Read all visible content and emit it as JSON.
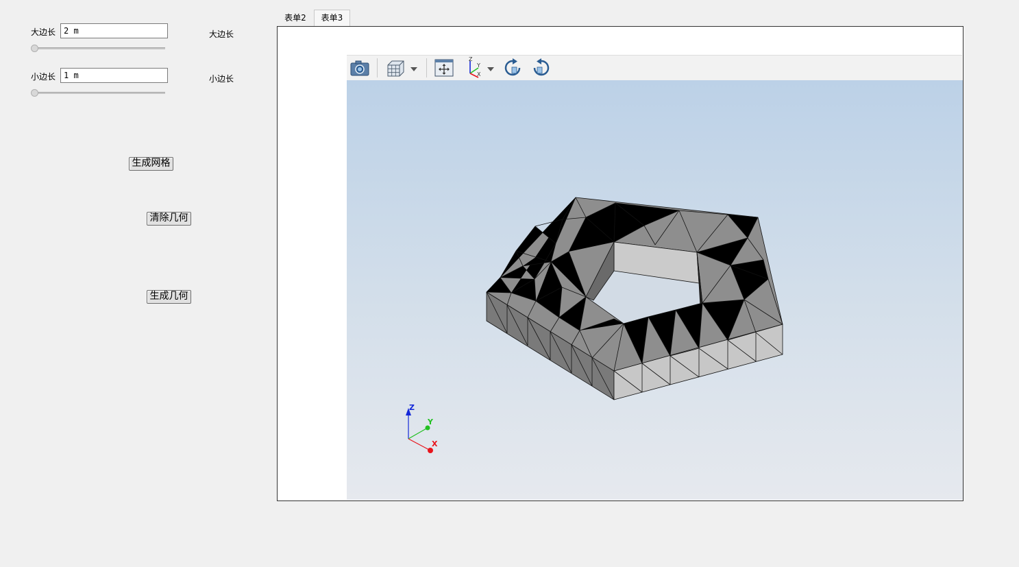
{
  "form": {
    "big_side_label": "大边长",
    "big_side_value": "2 m",
    "big_side_right_label": "大边长",
    "big_side_slider_level": 0,
    "small_side_label": "小边长",
    "small_side_value": "1 m",
    "small_side_right_label": "小边长",
    "small_side_slider_level": 0,
    "generate_mesh_label": "生成网格",
    "clear_geometry_label": "清除几何",
    "generate_geometry_label": "生成几何"
  },
  "tabs": [
    {
      "label": "表单2",
      "active": false
    },
    {
      "label": "表单3",
      "active": true
    }
  ],
  "toolbar": {
    "icons": [
      "camera-icon",
      "cube-view-icon",
      "fit-view-icon",
      "axes-icon",
      "rotate-cw-icon",
      "rotate-ccw-icon"
    ]
  },
  "axes_triad": {
    "x": "X",
    "y": "Y",
    "z": "Z"
  },
  "colors": {
    "x_axis": "#e8141c",
    "y_axis": "#22c022",
    "z_axis": "#1428d8",
    "mesh_top": "#8c8c8c",
    "mesh_side_light": "#c8c8c8",
    "mesh_side_dark": "#6e6e6e"
  }
}
